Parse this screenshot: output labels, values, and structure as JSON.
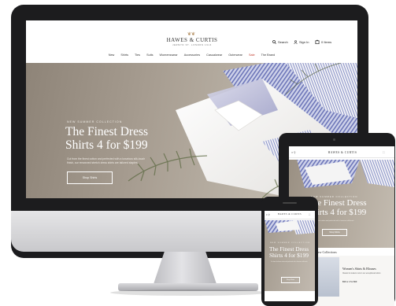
{
  "site": {
    "brand": "HAWES & CURTIS",
    "brand_sub": "JERMYN ST. LONDON 1913",
    "search_label": "Search",
    "signin_label": "Sign In",
    "bag_label": "0 Items",
    "nav": [
      "New",
      "Shirts",
      "Ties",
      "Suits",
      "Womenswear",
      "Accessories",
      "Casualwear",
      "Outerwear",
      "Sale",
      "The Brand"
    ],
    "sale_color": "#c0392b"
  },
  "hero": {
    "kicker": "NEW SUMMER COLLECTION",
    "title_line1": "The Finest Dress",
    "title_line2": "Shirts 4 for $199",
    "copy_line1": "Cut from the finest cotton and perfected with a luxurious silk-touch",
    "copy_line2": "finish, our renowned stretch dress shirts are tailored staples.",
    "button": "Shop Shirts"
  },
  "tablet": {
    "new_collections": "New Collections",
    "promo_title": "Women's Shirts & Blouses",
    "promo_copy": "Classic & modern cuts in our exceptional cotton",
    "promo_price": "$99 or 2 for $99"
  },
  "colors": {
    "device_bezel": "#1c1c1e",
    "hero_tone": "#a69c90",
    "accent_gold": "#b08a5a"
  }
}
